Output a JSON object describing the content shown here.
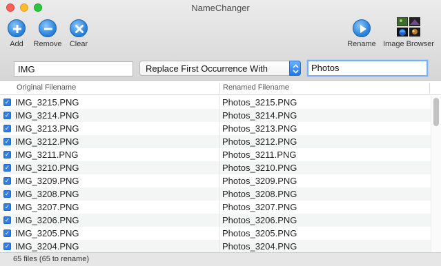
{
  "window": {
    "title": "NameChanger"
  },
  "toolbar": {
    "add": {
      "label": "Add",
      "icon": "plus-icon"
    },
    "remove": {
      "label": "Remove",
      "icon": "minus-icon"
    },
    "clear": {
      "label": "Clear",
      "icon": "x-icon"
    },
    "rename": {
      "label": "Rename",
      "icon": "play-icon"
    },
    "image_browser": {
      "label": "Image Browser",
      "icon": "image-browser-icon"
    }
  },
  "search": {
    "original_text": "IMG",
    "mode": "Replace First Occurrence With",
    "replacement_text": "Photos"
  },
  "table": {
    "headers": {
      "original": "Original Filename",
      "renamed": "Renamed Filename"
    },
    "rows": [
      {
        "checked": true,
        "original": "IMG_3215.PNG",
        "renamed": "Photos_3215.PNG"
      },
      {
        "checked": true,
        "original": "IMG_3214.PNG",
        "renamed": "Photos_3214.PNG"
      },
      {
        "checked": true,
        "original": "IMG_3213.PNG",
        "renamed": "Photos_3213.PNG"
      },
      {
        "checked": true,
        "original": "IMG_3212.PNG",
        "renamed": "Photos_3212.PNG"
      },
      {
        "checked": true,
        "original": "IMG_3211.PNG",
        "renamed": "Photos_3211.PNG"
      },
      {
        "checked": true,
        "original": "IMG_3210.PNG",
        "renamed": "Photos_3210.PNG"
      },
      {
        "checked": true,
        "original": "IMG_3209.PNG",
        "renamed": "Photos_3209.PNG"
      },
      {
        "checked": true,
        "original": "IMG_3208.PNG",
        "renamed": "Photos_3208.PNG"
      },
      {
        "checked": true,
        "original": "IMG_3207.PNG",
        "renamed": "Photos_3207.PNG"
      },
      {
        "checked": true,
        "original": "IMG_3206.PNG",
        "renamed": "Photos_3206.PNG"
      },
      {
        "checked": true,
        "original": "IMG_3205.PNG",
        "renamed": "Photos_3205.PNG"
      },
      {
        "checked": true,
        "original": "IMG_3204.PNG",
        "renamed": "Photos_3204.PNG"
      }
    ]
  },
  "status": {
    "text": "65 files (65 to rename)"
  },
  "colors": {
    "accent": "#2d86de",
    "checkbox": "#2d7ee6",
    "focus_ring": "#7eaef2"
  }
}
